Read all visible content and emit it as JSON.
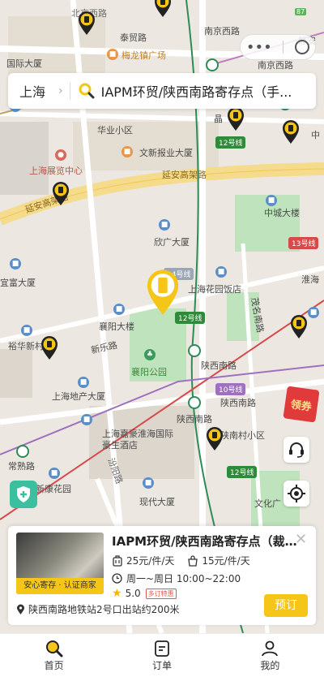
{
  "status": {
    "battery": "87"
  },
  "search": {
    "city": "上海",
    "query": "IAPM环贸/陕西南路寄存点（手..."
  },
  "map_labels": {
    "top": [
      "北京西路",
      "泰贸路",
      "南京西路",
      "梅龙镇广场",
      "国际大厦",
      "南京西路",
      "静安"
    ],
    "mid": [
      "华业小区",
      "晶",
      "中",
      "文新报业大厦",
      "上海展览中心",
      "延安高架路",
      "延安高架路",
      "中城大楼",
      "欣广大厦",
      "上海花园饭店",
      "淮海",
      "宜富大厦",
      "襄阳大楼",
      "新乐路",
      "茂名南路",
      "襄阳公园",
      "裕华新村",
      "陕西南路",
      "上海地产大厦"
    ],
    "low": [
      "陕西南路",
      "陕西南路",
      "上海嘉豪淮海国际豪生酒店",
      "陕南村小区",
      "常熟路",
      "新康花园",
      "汾阳路",
      "现代大厦",
      "文化广"
    ],
    "metro_badges": [
      "12号线",
      "13号线",
      "14号线",
      "12号线",
      "10号线",
      "12号线"
    ]
  },
  "side_buttons": {
    "coupon": "领券"
  },
  "card": {
    "title": "IAPM环贸/陕西南路寄存点（裁缝...",
    "thumb_caption": "安心寄存 · 认证商家",
    "price_small": "25元/件/天",
    "price_bag": "15元/件/天",
    "hours": "周一~周日 10:00~22:00",
    "hours_tag": "多订特惠",
    "rating": "5.0",
    "address": "陕西南路地铁站2号口出站约200米",
    "book_label": "预订"
  },
  "tabs": [
    {
      "label": "首页",
      "icon": "search-icon",
      "active": true
    },
    {
      "label": "订单",
      "icon": "order-icon",
      "active": false
    },
    {
      "label": "我的",
      "icon": "user-icon",
      "active": false
    }
  ],
  "colors": {
    "accent": "#f5c518",
    "metro_green": "#2e8b57",
    "road": "#f2dc9a"
  }
}
